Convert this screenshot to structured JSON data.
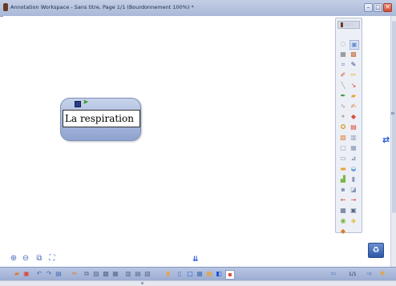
{
  "titlebar": {
    "title": "Annotation Workspace - Sans titre, Page 1/1  (Bourdonnement 100%) *",
    "minimize": "–",
    "maximize": "□",
    "close": "✕"
  },
  "node": {
    "label": "La respiration"
  },
  "statusbar": {
    "page_indicator": "1/1"
  },
  "icons": {
    "palette_tools": [
      "pointer-icon",
      "select-icon",
      "text-icon",
      "image-icon",
      "lasso-icon",
      "pen-icon",
      "marker-icon",
      "highlighter-icon",
      "line-icon",
      "arrow-icon",
      "shape-icon",
      "eraser-icon",
      "curve-icon",
      "brush-icon",
      "star-icon",
      "fill-icon",
      "stamp-icon",
      "table-icon",
      "calendar-icon",
      "chart-icon",
      "note-icon",
      "link-icon",
      "ruler-icon",
      "protractor-icon",
      "spotlight-icon",
      "screen-icon",
      "document-icon",
      "camera-icon",
      "record-icon",
      "arrow-left-icon",
      "grid-icon",
      "layers-icon",
      "globe-icon",
      "tag-icon",
      "clock-icon",
      "shape-add-icon"
    ],
    "bottom_tools": [
      "open-folder-icon",
      "save-icon",
      "undo-icon",
      "redo-icon",
      "print-icon",
      "cut-icon",
      "copy-icon",
      "paste-icon",
      "delete-icon",
      "group-icon",
      "ungroup-icon",
      "bring-front-icon",
      "send-back-icon",
      "align-icon",
      "zoom-icon",
      "new-page-icon",
      "insert-icon",
      "blank-page-icon",
      "duplicate-page-icon",
      "color-icon",
      "fill-icon",
      "record-icon"
    ]
  },
  "colors": {
    "accent_blue": "#1c55d8",
    "titlebar": "#b4c1df",
    "card": "#9fb1d9"
  }
}
